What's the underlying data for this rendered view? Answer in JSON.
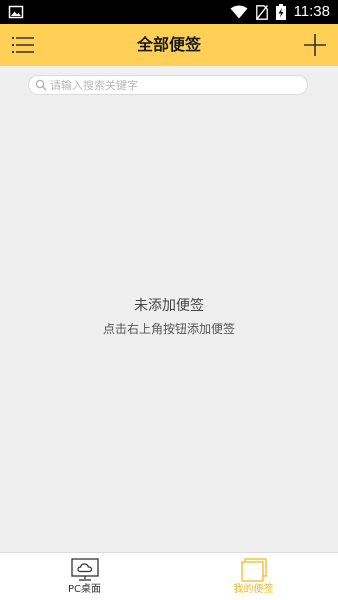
{
  "status_bar": {
    "time": "11:38",
    "left_icon": "image-icon",
    "right_icons": [
      "wifi-icon",
      "no-sim-icon",
      "battery-charging-icon"
    ]
  },
  "header": {
    "title": "全部便签",
    "menu_icon": "menu-icon",
    "add_icon": "plus-icon",
    "background": "#ffd055"
  },
  "search": {
    "placeholder": "请输入搜索关键字",
    "value": ""
  },
  "empty_state": {
    "title": "未添加便签",
    "hint": "点击右上角按钮添加便签"
  },
  "bottom_nav": {
    "items": [
      {
        "label": "PC桌面",
        "icon": "monitor-cloud-icon",
        "active": false
      },
      {
        "label": "我的便签",
        "icon": "notes-icon",
        "active": true
      }
    ],
    "active_color": "#f5b921"
  }
}
